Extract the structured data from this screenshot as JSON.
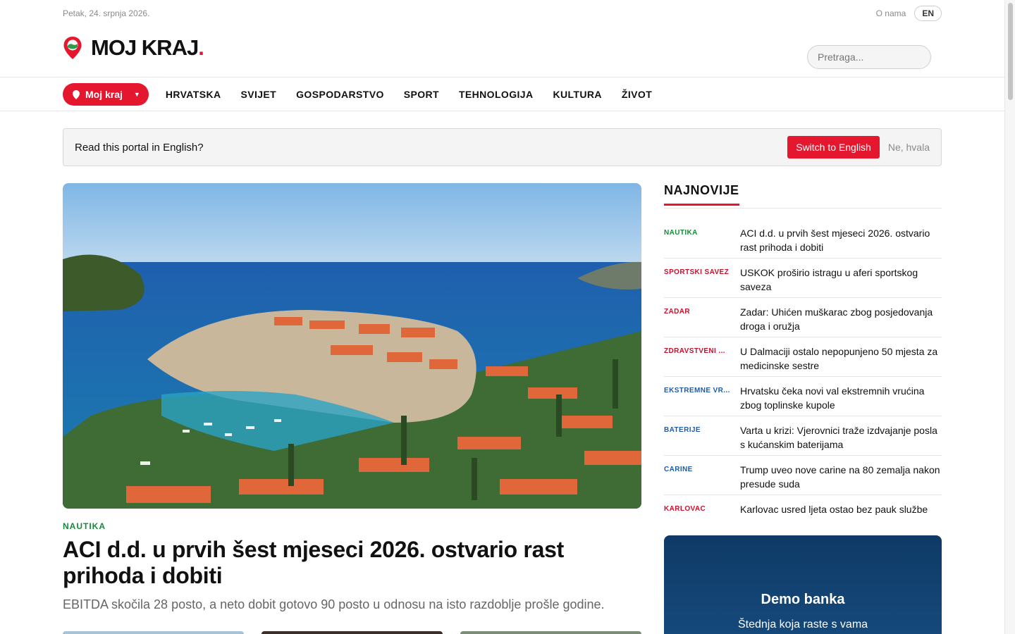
{
  "topbar": {
    "date": "Petak, 24. srpnja 2026.",
    "about": "O nama",
    "lang": "EN"
  },
  "logo": {
    "text": "MOJ KRAJ",
    "dot": "."
  },
  "search": {
    "placeholder": "Pretraga..."
  },
  "nav": {
    "region_button": "Moj kraj",
    "items": [
      "HRVATSKA",
      "SVIJET",
      "GOSPODARSTVO",
      "SPORT",
      "TEHNOLOGIJA",
      "KULTURA",
      "ŽIVOT"
    ]
  },
  "banner": {
    "question": "Read this portal in English?",
    "switch_label": "Switch to English",
    "decline_label": "Ne, hvala"
  },
  "featured": {
    "category": "NAUTIKA",
    "title": "ACI d.d. u prvih šest mjeseci 2026. ostvario rast prihoda i dobiti",
    "lede": "EBITDA skočila 28 posto, a neto dobit gotovo 90 posto u odnosu na isto razdoblje prošle godine."
  },
  "latest": {
    "heading": "NAJNOVIJE",
    "items": [
      {
        "tag": "NAUTIKA",
        "title": "ACI d.d. u prvih šest mjeseci 2026. ostvario rast prihoda i dobiti"
      },
      {
        "tag": "SPORTSKI SAVEZ",
        "title": "USKOK proširio istragu u aferi sportskog saveza"
      },
      {
        "tag": "ZADAR",
        "title": "Zadar: Uhićen muškarac zbog posjedovanja droga i oružja"
      },
      {
        "tag": "ZDRAVSTVENI ...",
        "title": "U Dalmaciji ostalo nepopunjeno 50 mjesta za medicinske sestre"
      },
      {
        "tag": "EKSTREMNE VR...",
        "title": "Hrvatsku čeka novi val ekstremnih vrućina zbog toplinske kupole"
      },
      {
        "tag": "BATERIJE",
        "title": "Varta u krizi: Vjerovnici traže izdvajanje posla s kućanskim baterijama"
      },
      {
        "tag": "CARINE",
        "title": "Trump uveo nove carine na 80 zemalja nakon presude suda"
      },
      {
        "tag": "KARLOVAC",
        "title": "Karlovac usred ljeta ostao bez pauk službe"
      }
    ]
  },
  "ad": {
    "name": "Demo banka",
    "slogan": "Štednja koja raste s vama"
  },
  "colors": {
    "accent": "#e4172f",
    "green_tag": "#178a3c",
    "red_tag": "#c8102e",
    "blue_tag": "#1f5aa8",
    "ad_bg": "#0f3a66"
  }
}
